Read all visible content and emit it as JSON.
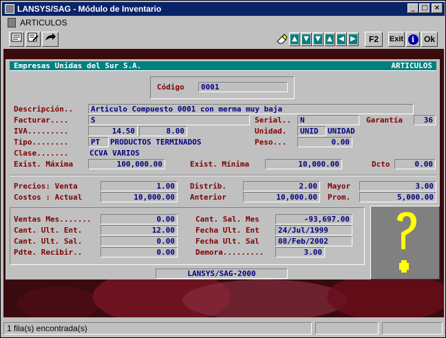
{
  "window": {
    "title": "LANSYS/SAG - Módulo de Inventario",
    "controls": {
      "minimize": "_",
      "maximize": "□",
      "close": "×"
    }
  },
  "menu": {
    "label": "ARTICULOS"
  },
  "toolbar": {
    "left_icons": [
      "doc-list-icon",
      "doc-edit-icon",
      "exit-arrow-icon"
    ],
    "eraser_icon": "eraser-icon",
    "nav_arrows": [
      "▲",
      "▼",
      "▼",
      "▲",
      "◀",
      "▶"
    ],
    "f2": "F2",
    "exit": "Exit",
    "info": "i",
    "ok": "Ok"
  },
  "header": {
    "company": "Empresas Unidas del Sur S.A.",
    "module": "ARTICULOS"
  },
  "form": {
    "codigo_label": "Código",
    "codigo": "0001",
    "descripcion_label": "Descripción..",
    "descripcion": "Articulo Compuesto 0001 con merma muy baja",
    "facturar_label": "Facturar....",
    "facturar": "S",
    "serial_label": "Serial..",
    "serial": "N",
    "garantia_label": "Garantía",
    "garantia": "36",
    "iva_label": "IVA.........",
    "iva1": "14.50",
    "iva2": "8.00",
    "unidad_label": "Unidad.",
    "unidad_code": "UNID",
    "unidad_desc": "UNIDAD",
    "tipo_label": "Tipo........",
    "tipo_code": "PT",
    "tipo_desc": "PRODUCTOS TERMINADOS",
    "peso_label": "Peso...",
    "peso": "0.00",
    "clase_label": "Clase.......",
    "clase": "CCVA VARIOS",
    "exist_max_label": "Exist. Máxima",
    "exist_max": "100,000.00",
    "exist_min_label": "Exist. Mínima",
    "exist_min": "10,000.00",
    "dcto_label": "Dcto",
    "dcto": "0.00",
    "precios_label": "Precios: Venta",
    "precio_venta": "1.00",
    "distrib_label": "Distrib.",
    "distrib": "2.00",
    "mayor_label": "Mayor",
    "mayor": "3.00",
    "costos_label": "Costos : Actual",
    "costo_actual": "10,000.00",
    "anterior_label": "Anterior",
    "anterior": "10,000.00",
    "prom_label": "Prom.",
    "prom": "5,000.00",
    "ventas_mes_label": "Ventas Mes.......",
    "ventas_mes": "0.00",
    "cant_ult_ent_label": "Cant. Ult. Ent.",
    "cant_ult_ent": "12.00",
    "cant_ult_sal_label": "Cant. Ult. Sal.",
    "cant_ult_sal": "0.00",
    "pdte_recibir_label": "Pdte. Recibir..",
    "pdte_recibir": "0.00",
    "cant_sal_mes_label": "Cant. Sal. Mes",
    "cant_sal_mes": "-93,697.00",
    "fecha_ult_ent_label": "Fecha Ult. Ent",
    "fecha_ult_ent": "24/Jul/1999",
    "fecha_ult_sal_label": "Fecha Ult. Sal",
    "fecha_ult_sal": "08/Feb/2002",
    "demora_label": "Demora.........",
    "demora": "3.00",
    "image_placeholder": "question-mark-icon",
    "footer": "LANSYS/SAG-2000"
  },
  "status": {
    "text": "1 fila(s) encontrada(s)"
  },
  "colors": {
    "title_bar": "#0a246a",
    "header_bar": "#008080",
    "label": "#800000",
    "value": "#000080",
    "background": "#3a0b0e",
    "question_mark": "#ffff00"
  }
}
